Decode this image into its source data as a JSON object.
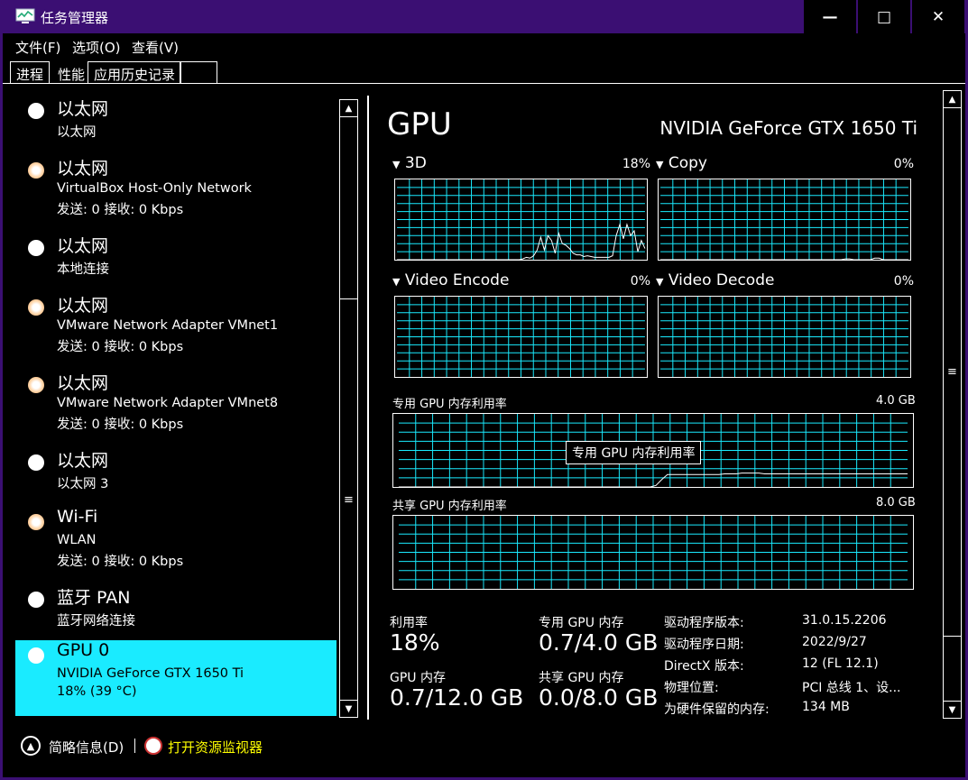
{
  "window": {
    "title": "任务管理器",
    "controls": {
      "minimize": "—",
      "maximize": "□",
      "close": "✕"
    }
  },
  "menu": [
    {
      "label": "文件(F)"
    },
    {
      "label": "选项(O)"
    },
    {
      "label": "查看(V)"
    }
  ],
  "tabs": [
    {
      "label": "进程"
    },
    {
      "label": "性能"
    },
    {
      "label": "应用历史记录"
    },
    {
      "label": ""
    }
  ],
  "sidebar": {
    "items": [
      {
        "title": "以太网",
        "line1": "以太网",
        "line2": "",
        "dot": "white"
      },
      {
        "title": "以太网",
        "line1": "VirtualBox Host-Only Network",
        "line2": "发送: 0 接收: 0 Kbps",
        "dot": "orange"
      },
      {
        "title": "以太网",
        "line1": "本地连接",
        "line2": "",
        "dot": "white"
      },
      {
        "title": "以太网",
        "line1": "VMware Network Adapter VMnet1",
        "line2": "发送: 0 接收: 0 Kbps",
        "dot": "orange"
      },
      {
        "title": "以太网",
        "line1": "VMware Network Adapter VMnet8",
        "line2": "发送: 0 接收: 0 Kbps",
        "dot": "orange"
      },
      {
        "title": "以太网",
        "line1": "以太网 3",
        "line2": "",
        "dot": "white"
      },
      {
        "title": "Wi-Fi",
        "line1": "WLAN",
        "line2": "发送: 0 接收: 0 Kbps",
        "dot": "orange"
      },
      {
        "title": "蓝牙 PAN",
        "line1": "蓝牙网络连接",
        "line2": "",
        "dot": "white"
      },
      {
        "title": "GPU 0",
        "line1": "NVIDIA GeForce GTX 1650 Ti",
        "line2": "18% (39 °C)",
        "dot": "white",
        "selected": true
      }
    ]
  },
  "main": {
    "heading": "GPU",
    "model": "NVIDIA GeForce GTX 1650 Ti",
    "engines": [
      {
        "label": "3D",
        "pct": "18%"
      },
      {
        "label": "Copy",
        "pct": "0%"
      },
      {
        "label": "Video Encode",
        "pct": "0%"
      },
      {
        "label": "Video Decode",
        "pct": "0%"
      }
    ],
    "dedicated_mem": {
      "label": "专用 GPU 内存利用率",
      "max": "4.0 GB",
      "tooltip": "专用 GPU 内存利用率"
    },
    "shared_mem": {
      "label": "共享 GPU 内存利用率",
      "max": "8.0 GB"
    },
    "stats": {
      "util_label": "利用率",
      "util_value": "18%",
      "ded_label": "专用 GPU 内存",
      "ded_value": "0.7/4.0 GB",
      "gpumem_label": "GPU 内存",
      "gpumem_value": "0.7/12.0 GB",
      "shared_label": "共享 GPU 内存",
      "shared_value": "0.0/8.0 GB"
    },
    "info": [
      {
        "k": "驱动程序版本:",
        "v": "31.0.15.2206"
      },
      {
        "k": "驱动程序日期:",
        "v": "2022/9/27"
      },
      {
        "k": "DirectX 版本:",
        "v": "12 (FL 12.1)"
      },
      {
        "k": "物理位置:",
        "v": "PCI 总线 1、设..."
      },
      {
        "k": "为硬件保留的内存:",
        "v": "134 MB"
      }
    ]
  },
  "bottom": {
    "collapse_label": "简略信息(D)",
    "resmon_label": "打开资源监视器"
  },
  "colors": {
    "titlebar": "#3b0f73",
    "selected": "#1aebff",
    "grid": "#1aebff",
    "link": "#ffff00"
  },
  "series_3d": [
    0,
    0,
    0,
    0,
    0,
    0,
    0,
    0,
    0,
    0,
    0,
    0,
    0,
    0,
    0,
    0,
    0,
    0,
    0,
    0,
    0,
    0,
    0,
    0,
    0,
    0,
    0,
    0,
    0,
    0,
    0,
    0,
    0,
    0,
    0,
    1,
    3,
    2,
    5,
    12,
    28,
    12,
    30,
    24,
    8,
    33,
    20,
    18,
    14,
    8,
    6,
    6,
    4,
    5,
    4,
    3,
    3,
    3,
    3,
    3,
    5,
    30,
    44,
    26,
    44,
    30,
    36,
    10,
    24,
    14
  ],
  "series_dedicated": [
    0,
    0,
    0,
    0,
    0,
    0,
    0,
    0,
    0,
    0,
    0,
    0,
    0,
    0,
    0,
    0,
    0,
    0,
    0,
    0,
    0,
    0,
    0,
    0,
    0,
    0,
    0,
    0,
    0,
    0,
    0,
    0,
    0,
    0,
    0,
    0,
    0,
    0,
    0,
    0,
    0,
    0,
    0,
    0,
    0,
    2,
    10,
    17,
    17,
    17,
    17,
    17,
    17,
    17,
    17,
    17,
    17,
    18,
    18,
    18,
    19,
    19,
    19,
    19,
    18,
    18,
    18,
    18,
    18,
    18,
    18,
    18,
    18,
    18,
    18,
    18,
    18,
    18,
    18,
    18,
    18,
    18,
    18,
    18,
    18,
    18,
    18,
    18,
    18,
    18
  ],
  "series_copy": [
    0,
    0,
    0,
    0,
    0,
    0,
    0,
    0,
    0,
    0,
    0,
    0,
    0,
    0,
    0,
    0,
    0,
    0,
    0,
    0,
    0,
    0,
    0,
    0,
    0,
    0,
    0,
    0,
    0,
    0,
    0,
    0,
    0,
    0,
    0,
    0,
    0,
    0,
    0,
    0,
    0,
    0,
    0,
    0,
    1,
    1,
    0,
    0,
    0,
    0,
    0,
    2,
    2,
    0,
    0,
    0,
    0,
    0,
    0,
    0
  ]
}
